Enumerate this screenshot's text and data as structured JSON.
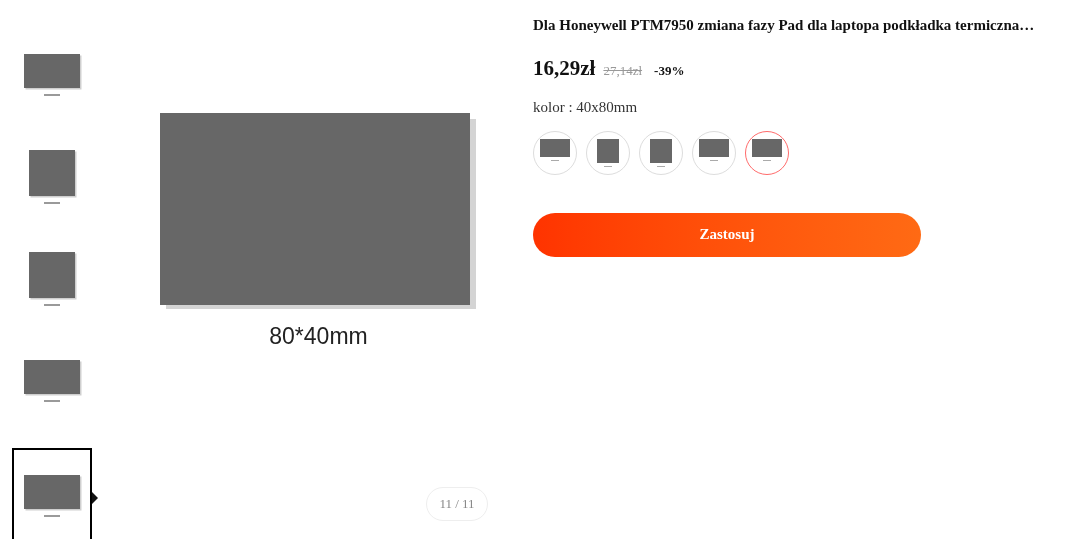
{
  "thumbnails": [
    {
      "selected": false
    },
    {
      "selected": false
    },
    {
      "selected": false
    },
    {
      "selected": false
    },
    {
      "selected": true
    }
  ],
  "main_image": {
    "caption": "80*40mm"
  },
  "pager": "11 / 11",
  "product": {
    "title": "Dla Honeywell PTM7950 zmiana fazy Pad dla laptopa podkładka termiczna…",
    "price": "16,29zł",
    "old_price": "27,14zł",
    "discount": "-39%",
    "option_label": "kolor : 40x80mm"
  },
  "variants": [
    {
      "selected": false
    },
    {
      "selected": false
    },
    {
      "selected": false
    },
    {
      "selected": false
    },
    {
      "selected": true
    }
  ],
  "apply_button": "Zastosuj"
}
